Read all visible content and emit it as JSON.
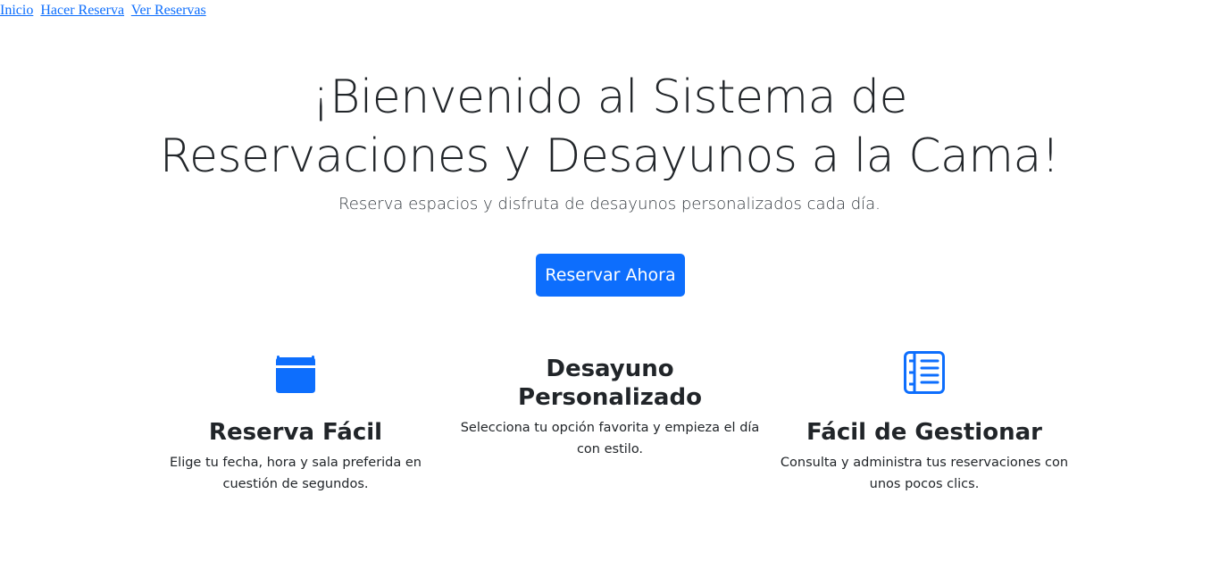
{
  "nav": {
    "links": [
      {
        "label": "Inicio"
      },
      {
        "label": "Hacer Reserva"
      },
      {
        "label": "Ver Reservas"
      }
    ]
  },
  "hero": {
    "title": "¡Bienvenido al Sistema de Reservaciones y Desayunos a la Cama!",
    "subtitle": "Reserva espacios y disfruta de desayunos personalizados cada día.",
    "cta_label": "Reservar Ahora"
  },
  "features": [
    {
      "icon": "calendar-icon",
      "title": "Reserva Fácil",
      "description": "Elige tu fecha, hora y sala preferida en cuestión de segundos."
    },
    {
      "icon": "",
      "title": "Desayuno Personalizado",
      "description": "Selecciona tu opción favorita y empieza el día con estilo."
    },
    {
      "icon": "journal-text-icon",
      "title": "Fácil de Gestionar",
      "description": "Consulta y administra tus reservaciones con unos pocos clics."
    }
  ],
  "colors": {
    "primary": "#0d6efd",
    "text": "#212529",
    "link": "#0d6efd"
  }
}
